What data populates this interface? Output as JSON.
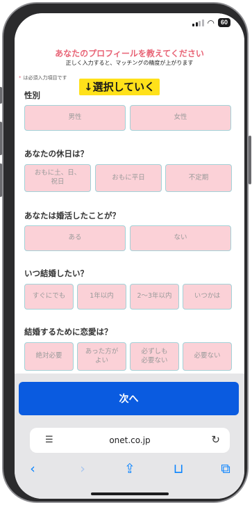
{
  "status": {
    "battery": "60"
  },
  "header": {
    "title": "あなたのプロフィールを教えてください",
    "subtitle": "正しく入力すると、マッチングの精度が上がります",
    "required_star": "*",
    "required_note": "は必須入力項目です",
    "annotation": "↓選択していく"
  },
  "questions": [
    {
      "label": "性別",
      "options": [
        "男性",
        "女性"
      ]
    },
    {
      "label": "あなたの休日は？",
      "options": [
        "おもに土、日、\n祝日",
        "おもに平日",
        "不定期"
      ]
    },
    {
      "label": "あなたは婚活したことが？",
      "options": [
        "ある",
        "ない"
      ]
    },
    {
      "label": "いつ結婚したい？",
      "options": [
        "すぐにでも",
        "1年以内",
        "2〜3年以内",
        "いつかは"
      ]
    },
    {
      "label": "結婚するために恋愛は？",
      "options": [
        "絶対必要",
        "あった方が\nよい",
        "必ずしも\n必要ない",
        "必要ない"
      ]
    }
  ],
  "next_button": {
    "label": "次へ"
  },
  "browser": {
    "url": "onet.co.jp",
    "icons": [
      "reader-icon",
      "reload-icon",
      "back-icon",
      "forward-icon",
      "share-icon",
      "bookmarks-icon",
      "tabs-icon"
    ]
  },
  "colors": {
    "title": "#e86476",
    "option_bg": "#fbd1d7",
    "option_border": "#a2d2d8",
    "next_button": "#0a5be0",
    "highlight": "#ffe11a"
  }
}
